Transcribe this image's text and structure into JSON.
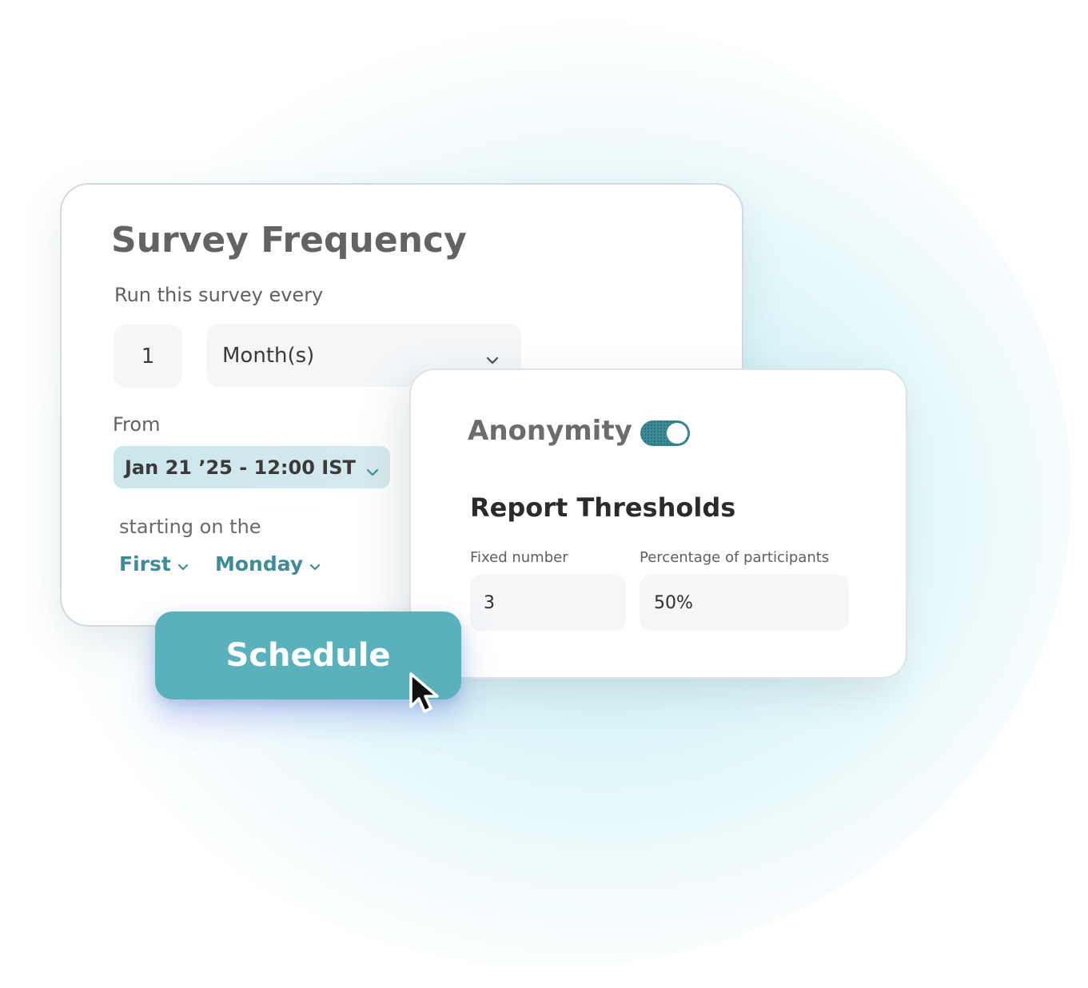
{
  "survey_frequency": {
    "title": "Survey Frequency",
    "run_label": "Run this survey every",
    "count_value": "1",
    "unit_value": "Month(s)",
    "from_label": "From",
    "date_value": "Jan 21 ’25 - 12:00 IST",
    "starting_label": "starting on the",
    "ordinal_value": "First",
    "weekday_value": "Monday"
  },
  "anonymity": {
    "label": "Anonymity",
    "enabled": true
  },
  "report_thresholds": {
    "title": "Report Thresholds",
    "fixed_label": "Fixed number",
    "fixed_value": "3",
    "percentage_label": "Percentage of participants",
    "percentage_value": "50%"
  },
  "actions": {
    "schedule_label": "Schedule"
  },
  "colors": {
    "accent": "#5ab1bb",
    "toggle": "#3a8b96",
    "link": "#3d8c97",
    "date_bg": "#cbe7eb"
  },
  "icons": {
    "chevron": "chevron-down-icon",
    "cursor": "mouse-pointer-icon"
  }
}
